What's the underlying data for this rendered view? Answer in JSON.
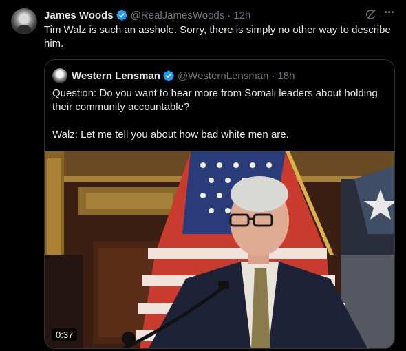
{
  "tweet": {
    "author_name": "James Woods",
    "handle": "@RealJamesWoods",
    "separator": "·",
    "time": "12h",
    "text": "Tim Walz is such an asshole. Sorry, there is simply no other way to describe him.",
    "icons": {
      "verified": "verified-badge-icon",
      "grok": "grok-icon",
      "more": "more-icon"
    },
    "colors": {
      "verified": "#1d9bf0",
      "muted": "#71767b",
      "text": "#e7e9ea",
      "background": "#000000",
      "border": "#2f3336"
    }
  },
  "quote": {
    "author_name": "Western Lensman",
    "handle": "@WesternLensman",
    "separator": "·",
    "time": "18h",
    "text": "Question: Do you want to hear more from Somali leaders about holding their community accountable?\n\nWalz: Let me tell you about how bad white men are.",
    "video": {
      "duration": "0:37"
    }
  }
}
